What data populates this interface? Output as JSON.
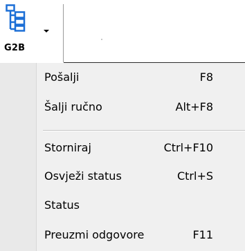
{
  "toolbar": {
    "button_label": "G2B",
    "icon": "tree-structure-icon",
    "arrow_icon": "dropdown-arrow-icon"
  },
  "colors": {
    "icon_blue": "#1c6fd6",
    "menu_background": "#f0f0f0",
    "gutter_background": "#e9e9e9"
  },
  "menu": {
    "items": [
      {
        "label": "Pošalji",
        "shortcut": "F8"
      },
      {
        "label": "Šalji ručno",
        "shortcut": "Alt+F8"
      },
      {
        "label": "Storniraj",
        "shortcut": "Ctrl+F10"
      },
      {
        "label": "Osvježi status",
        "shortcut": "Ctrl+S"
      },
      {
        "label": "Status",
        "shortcut": ""
      },
      {
        "label": "Preuzmi odgovore",
        "shortcut": "F11"
      }
    ]
  }
}
